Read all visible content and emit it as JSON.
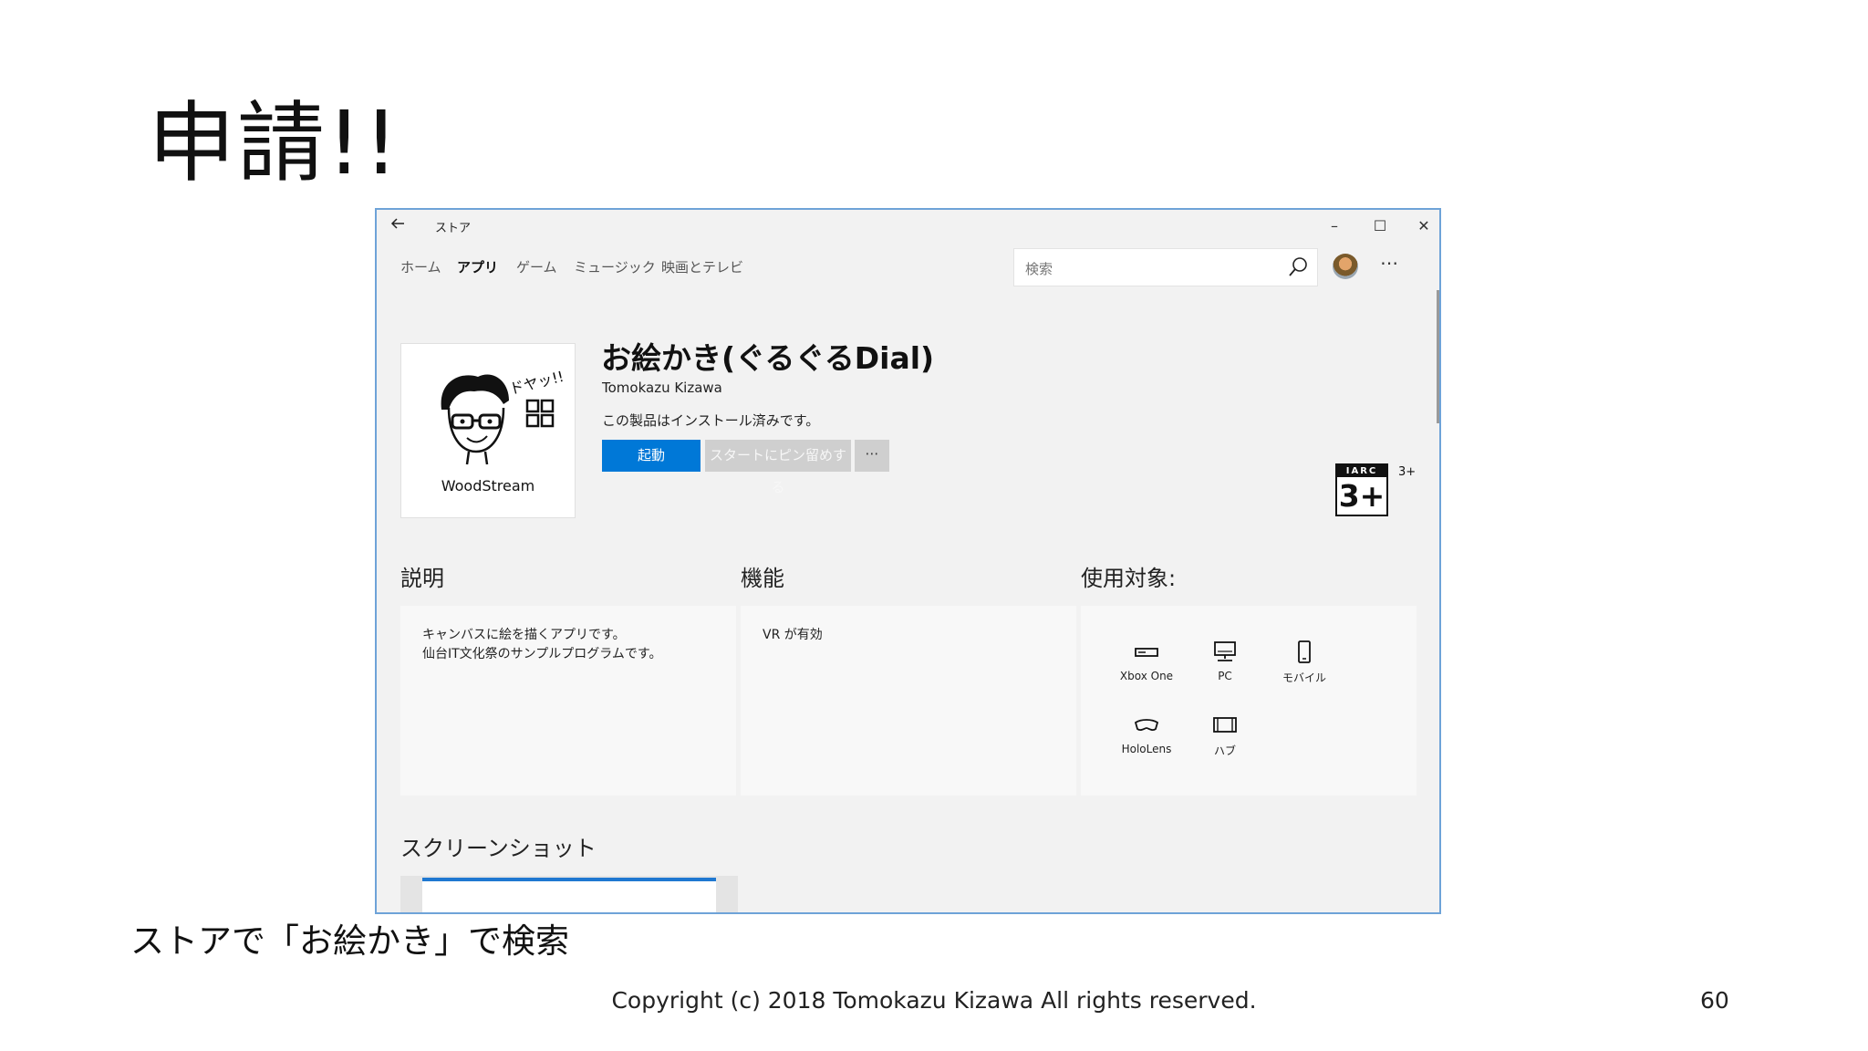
{
  "slide": {
    "title": "申請!!",
    "caption": "ストアで「お絵かき」で検索",
    "footer": "Copyright (c) 2018 Tomokazu Kizawa All rights reserved.",
    "page_number": "60"
  },
  "window": {
    "title": "ストア",
    "back_icon": "arrow-left-icon",
    "minimize": "–",
    "maximize": "☐",
    "close": "✕"
  },
  "nav": {
    "items": [
      {
        "label": "ホーム",
        "active": false
      },
      {
        "label": "アプリ",
        "active": true
      },
      {
        "label": "ゲーム",
        "active": false
      },
      {
        "label": "ミュージック",
        "active": false
      },
      {
        "label": "映画とテレビ",
        "active": false
      }
    ],
    "search_placeholder": "検索",
    "more": "⋯"
  },
  "app": {
    "tile_caption_top": "ドヤッ!!",
    "tile_name": "WoodStream",
    "title": "お絵かき(ぐるぐるDial)",
    "developer": "Tomokazu Kizawa",
    "status": "この製品はインストール済みです。",
    "launch_label": "起動",
    "pin_label": "スタートにピン留めする",
    "more_label": "⋯",
    "rating_top": "IARC",
    "rating_age": "3+",
    "rating_side": "3+",
    "accent_color": "#0078d7"
  },
  "sections": {
    "description": {
      "heading": "説明",
      "lines": [
        "キャンバスに絵を描くアプリです。",
        "仙台IT文化祭のサンプルプログラムです。"
      ]
    },
    "features": {
      "heading": "機能",
      "lines": [
        "VR が有効"
      ]
    },
    "available": {
      "heading": "使用対象:",
      "devices": [
        {
          "label": "Xbox One",
          "icon": "xbox-icon"
        },
        {
          "label": "PC",
          "icon": "pc-icon"
        },
        {
          "label": "モバイル",
          "icon": "mobile-icon"
        },
        {
          "label": "HoloLens",
          "icon": "hololens-icon"
        },
        {
          "label": "ハブ",
          "icon": "hub-icon"
        }
      ]
    },
    "screenshots": {
      "heading": "スクリーンショット"
    }
  }
}
